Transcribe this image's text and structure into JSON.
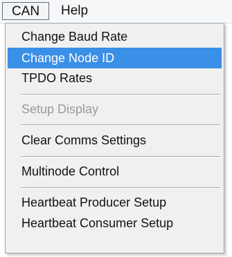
{
  "menubar": {
    "items": [
      {
        "label": "CAN",
        "active": true
      },
      {
        "label": "Help",
        "active": false
      }
    ]
  },
  "menu": {
    "highlight_color": "#3a8fe6",
    "items": [
      {
        "label": "Change Baud Rate",
        "state": "normal"
      },
      {
        "label": "Change Node ID",
        "state": "highlighted"
      },
      {
        "label": "TPDO Rates",
        "state": "normal"
      },
      {
        "label": "Setup Display",
        "state": "disabled"
      },
      {
        "label": "Clear Comms Settings",
        "state": "normal"
      },
      {
        "label": "Multinode Control",
        "state": "normal"
      },
      {
        "label": "Heartbeat Producer Setup",
        "state": "normal"
      },
      {
        "label": "Heartbeat Consumer Setup",
        "state": "normal"
      }
    ]
  }
}
